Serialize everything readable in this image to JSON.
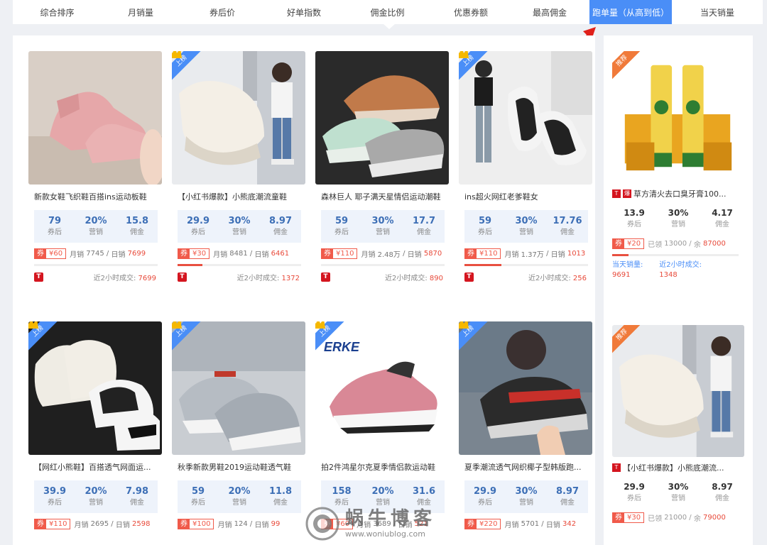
{
  "sort_tabs": [
    {
      "label": "综合排序"
    },
    {
      "label": "月销量"
    },
    {
      "label": "券后价"
    },
    {
      "label": "好单指数"
    },
    {
      "label": "佣金比例"
    },
    {
      "label": "优惠券额"
    },
    {
      "label": "最高佣金"
    },
    {
      "label": "跑单量（从高到低）"
    },
    {
      "label": "当天销量"
    }
  ],
  "active_sort_index": 7,
  "labels": {
    "after_coupon": "券后",
    "commission_rate": "营销",
    "commission": "佣金",
    "coupon_tag": "券",
    "monthly": "月销",
    "daily": "日销",
    "recent2h": "近2小时成交:",
    "on_list": "上榜",
    "recommend": "推荐",
    "sold_prefix": "已领",
    "remain_prefix": "余",
    "today_sales": "当天销量:",
    "recent2h_side": "近2小时成交:"
  },
  "products": [
    {
      "title": "新款女鞋飞织鞋百搭ins运动板鞋",
      "price": "79",
      "rate": "20%",
      "commission": "15.8",
      "coupon": "¥60",
      "monthly": "7745",
      "daily": "7699",
      "recent": "7699",
      "progress": 0,
      "badge": false,
      "img": "pink"
    },
    {
      "title": "【小红书爆款】小熊底潮流童鞋",
      "price": "29.9",
      "rate": "30%",
      "commission": "8.97",
      "coupon": "¥30",
      "monthly": "8481",
      "daily": "6461",
      "recent": "1372",
      "progress": 0.2,
      "badge": true,
      "img": "kid"
    },
    {
      "title": "森林巨人 耶子满天星情侣运动潮鞋",
      "price": "59",
      "rate": "30%",
      "commission": "17.7",
      "coupon": "¥110",
      "monthly": "2.48万",
      "daily": "5870",
      "recent": "890",
      "progress": 0,
      "badge": false,
      "img": "blade"
    },
    {
      "title": "ins超火网红老爹鞋女",
      "price": "59",
      "rate": "30%",
      "commission": "17.76",
      "coupon": "¥110",
      "monthly": "1.37万",
      "daily": "1013",
      "recent": "256",
      "progress": 0.3,
      "badge": true,
      "img": "dad"
    },
    {
      "title": "【网红小熊鞋】百搭透气网面运...",
      "price": "39.9",
      "rate": "20%",
      "commission": "7.98",
      "coupon": "¥110",
      "monthly": "2695",
      "daily": "2598",
      "recent": "",
      "progress": 0,
      "badge": true,
      "img": "bear"
    },
    {
      "title": "秋季新款男鞋2019运动鞋透气鞋",
      "price": "59",
      "rate": "20%",
      "commission": "11.8",
      "coupon": "¥100",
      "monthly": "124",
      "daily": "99",
      "recent": "",
      "progress": 0,
      "badge": true,
      "img": "grey"
    },
    {
      "title": "拍2件鸿星尔克夏季情侣款运动鞋",
      "price": "158",
      "rate": "20%",
      "commission": "31.6",
      "coupon": "¥60",
      "monthly": "3689",
      "daily": "521",
      "recent": "",
      "progress": 0,
      "badge": true,
      "img": "erke"
    },
    {
      "title": "夏季潮流透气网织椰子型韩版跑...",
      "price": "29.9",
      "rate": "30%",
      "commission": "8.97",
      "coupon": "¥220",
      "monthly": "5701",
      "daily": "342",
      "recent": "",
      "progress": 0,
      "badge": true,
      "img": "black"
    }
  ],
  "side_products": [
    {
      "title": "草方清火去口臭牙膏100...",
      "price": "13.9",
      "rate": "30%",
      "commission": "4.17",
      "coupon": "¥20",
      "taken": "13000",
      "remain": "87000",
      "today": "9691",
      "recent": "1348",
      "img": "paste"
    },
    {
      "title": "【小红书爆款】小熊底潮流...",
      "price": "29.9",
      "rate": "30%",
      "commission": "8.97",
      "coupon": "¥30",
      "taken": "21000",
      "remain": "79000",
      "img": "kid"
    }
  ],
  "brand_logo_text": "ERKE",
  "watermark": {
    "big": "蜗牛博客",
    "small": "www.woniublog.com",
    "logo": "cloud-logo"
  }
}
